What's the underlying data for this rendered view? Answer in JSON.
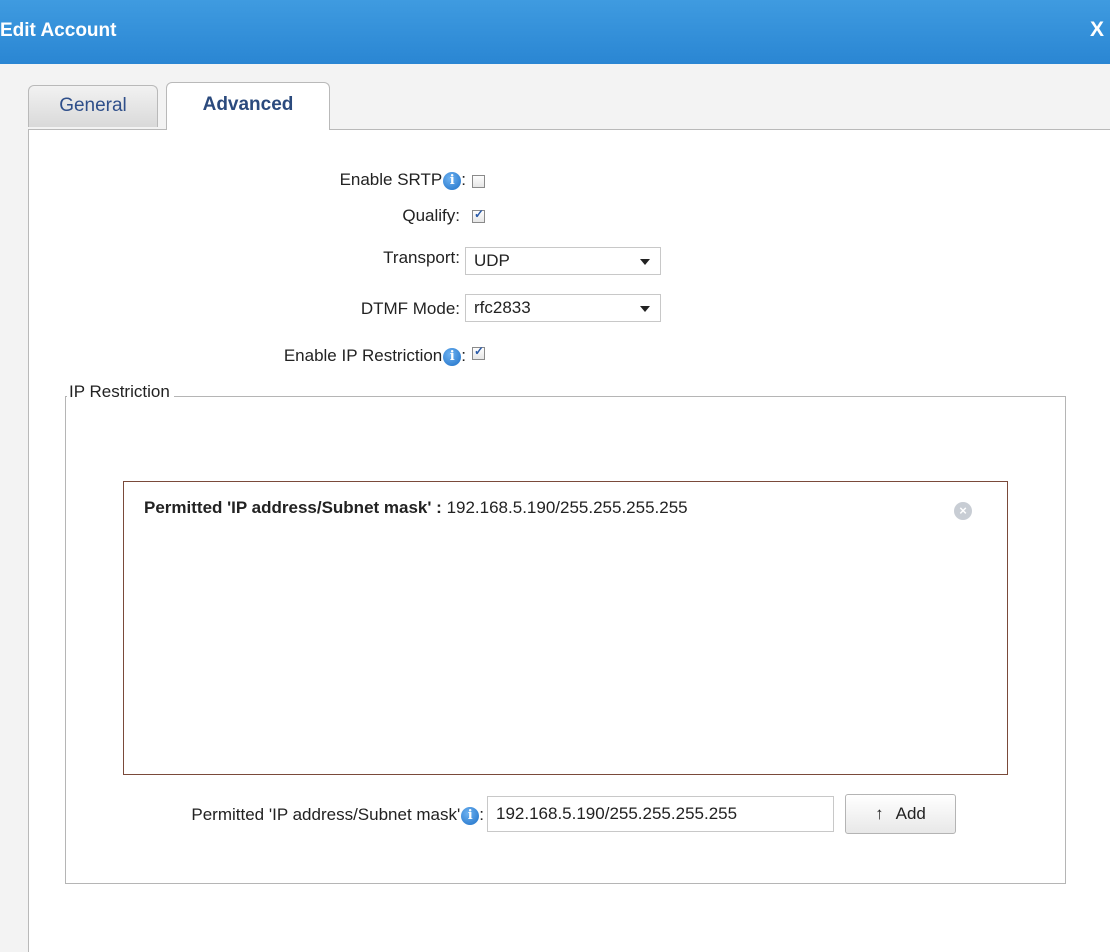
{
  "dialog": {
    "title": "Edit Account",
    "close_label": "X"
  },
  "tabs": [
    {
      "label": "General",
      "active": false
    },
    {
      "label": "Advanced",
      "active": true
    }
  ],
  "fields": {
    "enable_srtp": {
      "label": "Enable SRTP",
      "checked": false
    },
    "qualify": {
      "label": "Qualify:",
      "checked": true
    },
    "transport": {
      "label": "Transport:",
      "value": "UDP"
    },
    "dtmf_mode": {
      "label": "DTMF Mode:",
      "value": "rfc2833"
    },
    "enable_ip_restriction": {
      "label": "Enable IP Restriction",
      "checked": true
    }
  },
  "ip_restriction": {
    "legend": "IP Restriction",
    "entries": [
      {
        "label": "Permitted 'IP address/Subnet mask' :",
        "value": "192.168.5.190/255.255.255.255"
      }
    ],
    "input_label": "Permitted 'IP address/Subnet mask'",
    "input_value": "192.168.5.190/255.255.255.255",
    "add_label": "Add",
    "add_icon": "up-arrow"
  },
  "colors": {
    "titlebar": "#2a86d3",
    "tab_text": "#2b4a7d",
    "info_icon": "#1d6fc6"
  }
}
